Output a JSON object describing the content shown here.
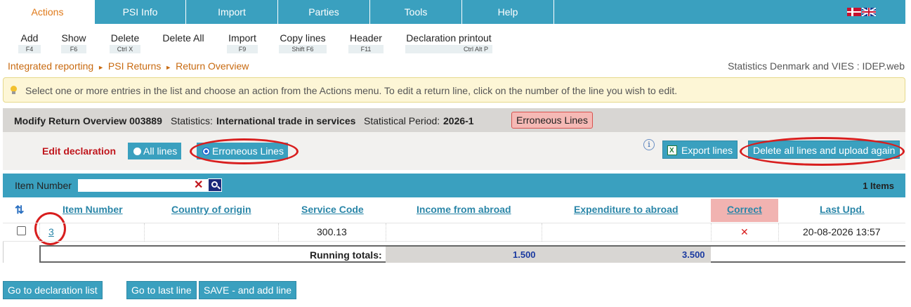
{
  "menu": {
    "tabs": [
      "Actions",
      "PSI Info",
      "Import",
      "Parties",
      "Tools",
      "Help"
    ],
    "active": "Actions",
    "languages": [
      "Danish",
      "English"
    ]
  },
  "toolbar": [
    {
      "label": "Add",
      "key": "F4"
    },
    {
      "label": "Show",
      "key": "F6"
    },
    {
      "label": "Delete",
      "key": "Ctrl X"
    },
    {
      "label": "Delete All",
      "key": ""
    },
    {
      "label": "Import",
      "key": "F9"
    },
    {
      "label": "Copy lines",
      "key": "Shift F6"
    },
    {
      "label": "Header",
      "key": "F11"
    },
    {
      "label": "Declaration printout",
      "key": "Ctrl Alt P"
    }
  ],
  "breadcrumb": [
    "Integrated reporting",
    "PSI Returns",
    "Return Overview"
  ],
  "site_name": "Statistics Denmark and VIES : IDEP.web",
  "info_message": "Select one or more entries in the list and choose an action from the Actions menu. To edit a return line, click on the number of the line you wish to edit.",
  "header": {
    "title": "Modify Return Overview 003889",
    "statistics_label": "Statistics:",
    "statistics_value": "International trade in services",
    "period_label": "Statistical Period:",
    "period_value": "2026-1",
    "error_badge": "Erroneous Lines"
  },
  "edit": {
    "label": "Edit declaration",
    "option_all": "All lines",
    "option_erroneous": "Erroneous Lines",
    "selected": "Erroneous Lines",
    "export_button": "Export lines",
    "delete_upload_button": "Delete all lines and upload again"
  },
  "search": {
    "label": "Item Number",
    "value": "",
    "items_count": "1 Items"
  },
  "table": {
    "columns": [
      "Item Number",
      "Country of origin",
      "Service Code",
      "Income from abroad",
      "Expenditure to abroad",
      "Correct",
      "Last Upd."
    ],
    "rows": [
      {
        "item_number": "3",
        "country": "",
        "service_code": "300.13",
        "income": "",
        "expenditure": "",
        "correct": "✕",
        "last_upd": "20-08-2026 13:57"
      }
    ],
    "totals_label": "Running totals:",
    "total_income": "1.500",
    "total_expenditure": "3.500"
  },
  "footer_buttons": [
    "Go to declaration list",
    "Go to last line",
    "SAVE - and add line"
  ],
  "colors": {
    "accent": "#3aa0bf",
    "orange": "#e07a1a",
    "error": "#d81e1e"
  }
}
